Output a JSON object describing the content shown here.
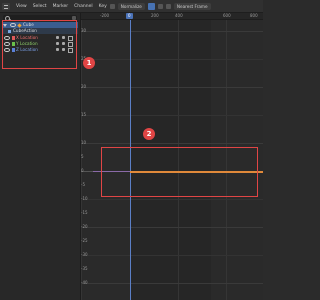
{
  "menubar": {
    "items": [
      "View",
      "Select",
      "Marker",
      "Channel",
      "Key"
    ],
    "normalize_label": "Normalize",
    "snap_label": "Nearest Frame"
  },
  "channels": {
    "object_label": "Cube",
    "action_label": "CubeAction",
    "x_label": "X Location",
    "y_label": "Y Location",
    "z_label": "Z Location"
  },
  "timeline": {
    "ticks": [
      "-200",
      "0",
      "200",
      "400",
      "600",
      "800"
    ],
    "current_frame": "0"
  },
  "graph": {
    "y_ticks": [
      "30",
      "25",
      "20",
      "15",
      "10",
      "5",
      "0",
      "-5",
      "-10",
      "-15",
      "-20",
      "-25",
      "-30",
      "-35",
      "-40"
    ]
  },
  "annotations": {
    "badge1": "1",
    "badge2": "2"
  },
  "colors": {
    "x_channel": "#e05a5a",
    "y_channel": "#6ac04a",
    "z_channel": "#5a80d8",
    "selection_highlight": "#3a5d8f",
    "curve_selected": "#e0893a",
    "annotation_red": "#e04545"
  }
}
